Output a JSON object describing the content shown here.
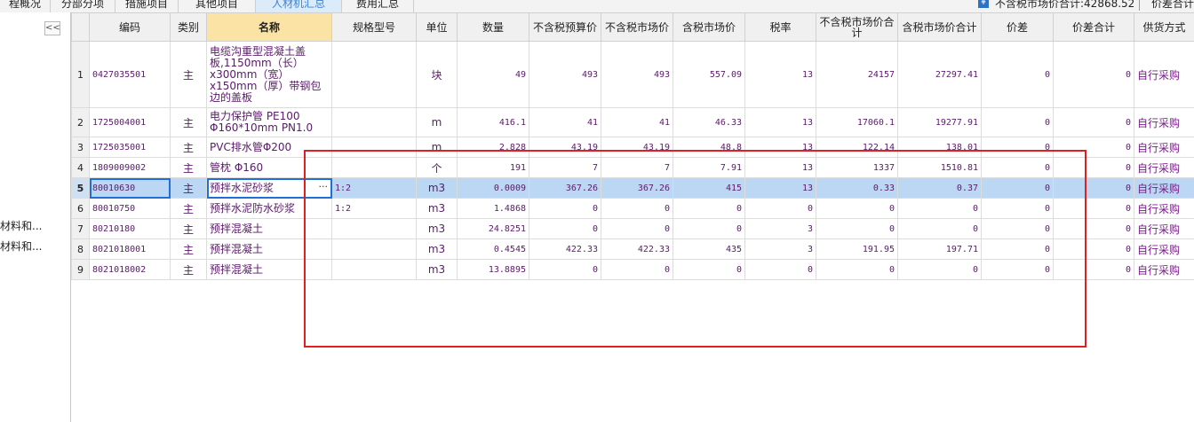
{
  "tabs": [
    {
      "label": "程概况",
      "active": false
    },
    {
      "label": "分部分项",
      "active": false
    },
    {
      "label": "措施项目",
      "active": false
    },
    {
      "label": "其他项目",
      "active": false
    },
    {
      "label": "人材机汇总",
      "active": true
    },
    {
      "label": "费用汇总",
      "active": false
    }
  ],
  "summary": {
    "market_total": "不含税市场价合计:42868.52",
    "price_diff_total": "价差合计"
  },
  "sidebar": {
    "collapse_glyph": "<<",
    "items": [
      "材料和...",
      "材料和..."
    ]
  },
  "columns": [
    "",
    "编码",
    "类别",
    "名称",
    "规格型号",
    "单位",
    "数量",
    "不含税预算价",
    "不含税市场价",
    "含税市场价",
    "税率",
    "不含税市场价合计",
    "含税市场价合计",
    "价差",
    "价差合计",
    "供货方式"
  ],
  "rows": [
    {
      "no": "1",
      "code": "0427035501",
      "kind": "主",
      "name": "电缆沟重型混凝土盖板,1150mm（长）x300mm（宽）x150mm（厚）带钢包边的盖板",
      "spec": "",
      "unit": "块",
      "qty": "49",
      "budget": "493",
      "market": "493",
      "taxed": "557.09",
      "rate": "13",
      "total": "24157",
      "taxed_total": "27297.41",
      "diff": "0",
      "diff_total": "0",
      "supply": "自行采购"
    },
    {
      "no": "2",
      "code": "1725004001",
      "kind": "主",
      "name": "电力保护管 PE100 Φ160*10mm PN1.0",
      "spec": "",
      "unit": "m",
      "qty": "416.1",
      "budget": "41",
      "market": "41",
      "taxed": "46.33",
      "rate": "13",
      "total": "17060.1",
      "taxed_total": "19277.91",
      "diff": "0",
      "diff_total": "0",
      "supply": "自行采购"
    },
    {
      "no": "3",
      "code": "1725035001",
      "kind": "主",
      "name": "PVC排水管Φ200",
      "spec": "",
      "unit": "m",
      "qty": "2.828",
      "budget": "43.19",
      "market": "43.19",
      "taxed": "48.8",
      "rate": "13",
      "total": "122.14",
      "taxed_total": "138.01",
      "diff": "0",
      "diff_total": "0",
      "supply": "自行采购"
    },
    {
      "no": "4",
      "code": "1809009002",
      "kind": "主",
      "name": "管枕 Φ160",
      "spec": "",
      "unit": "个",
      "qty": "191",
      "budget": "7",
      "market": "7",
      "taxed": "7.91",
      "rate": "13",
      "total": "1337",
      "taxed_total": "1510.81",
      "diff": "0",
      "diff_total": "0",
      "supply": "自行采购"
    },
    {
      "no": "5",
      "code": "80010630",
      "kind": "主",
      "name": "预拌水泥砂浆",
      "spec": "1:2",
      "unit": "m3",
      "qty": "0.0009",
      "budget": "367.26",
      "market": "367.26",
      "taxed": "415",
      "rate": "13",
      "total": "0.33",
      "taxed_total": "0.37",
      "diff": "0",
      "diff_total": "0",
      "supply": "自行采购",
      "selected": true
    },
    {
      "no": "6",
      "code": "80010750",
      "kind": "主",
      "name": "预拌水泥防水砂浆",
      "spec": "1:2",
      "unit": "m3",
      "qty": "1.4868",
      "budget": "0",
      "market": "0",
      "taxed": "0",
      "rate": "0",
      "total": "0",
      "taxed_total": "0",
      "diff": "0",
      "diff_total": "0",
      "supply": "自行采购"
    },
    {
      "no": "7",
      "code": "80210180",
      "kind": "主",
      "name": "预拌混凝土",
      "spec": "",
      "unit": "m3",
      "qty": "24.8251",
      "budget": "0",
      "market": "0",
      "taxed": "0",
      "rate": "3",
      "total": "0",
      "taxed_total": "0",
      "diff": "0",
      "diff_total": "0",
      "supply": "自行采购"
    },
    {
      "no": "8",
      "code": "8021018001",
      "kind": "主",
      "name": "预拌混凝土",
      "spec": "",
      "unit": "m3",
      "qty": "0.4545",
      "budget": "422.33",
      "market": "422.33",
      "taxed": "435",
      "rate": "3",
      "total": "191.95",
      "taxed_total": "197.71",
      "diff": "0",
      "diff_total": "0",
      "supply": "自行采购"
    },
    {
      "no": "9",
      "code": "8021018002",
      "kind": "主",
      "name": "预拌混凝土",
      "spec": "",
      "unit": "m3",
      "qty": "13.8895",
      "budget": "0",
      "market": "0",
      "taxed": "0",
      "rate": "0",
      "total": "0",
      "taxed_total": "0",
      "diff": "0",
      "diff_total": "0",
      "supply": "自行采购"
    }
  ],
  "annotation_color": "#e02020",
  "selection_color": "#bcd7f3"
}
